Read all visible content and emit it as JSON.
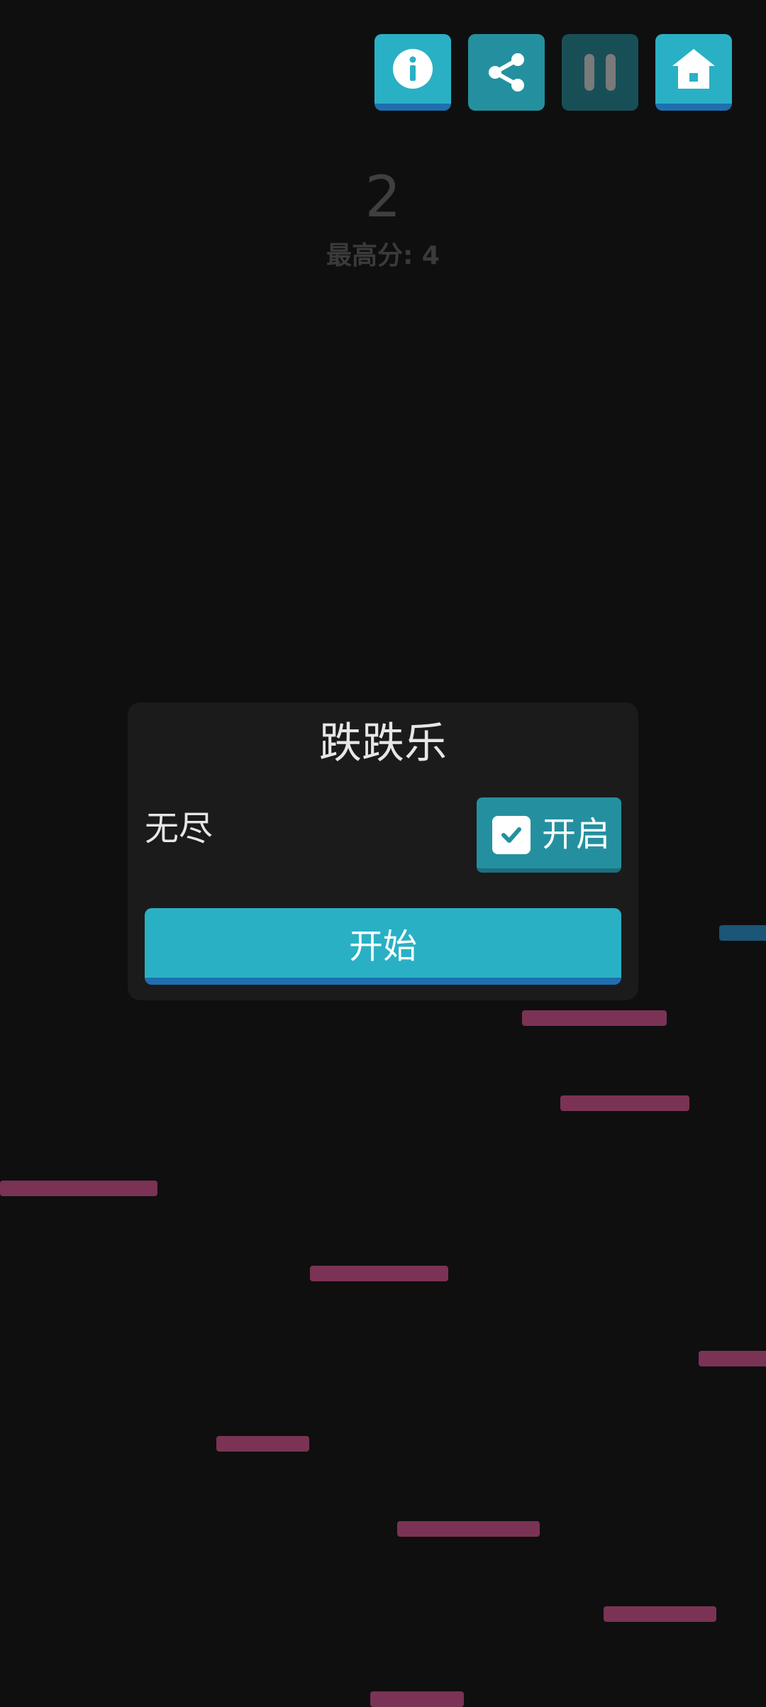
{
  "toolbar": {
    "info_icon": "info-icon",
    "share_icon": "share-icon",
    "pause_icon": "pause-icon",
    "home_icon": "home-icon"
  },
  "score": {
    "current": "2",
    "best_text": "最高分: 4"
  },
  "dialog": {
    "title": "跌跌乐",
    "endless_label": "无尽",
    "endless_toggle": {
      "label": "开启",
      "checked": true
    },
    "start_button": "开始"
  },
  "colors": {
    "background": "#0f0f0f",
    "accent": "#2ab0c4",
    "accent_dark": "#24909f",
    "accent_shadow": "#1f6fb0",
    "dialog_bg": "#1b1b1b",
    "platform": "#7a3354",
    "platform_blue": "#1b5577"
  }
}
